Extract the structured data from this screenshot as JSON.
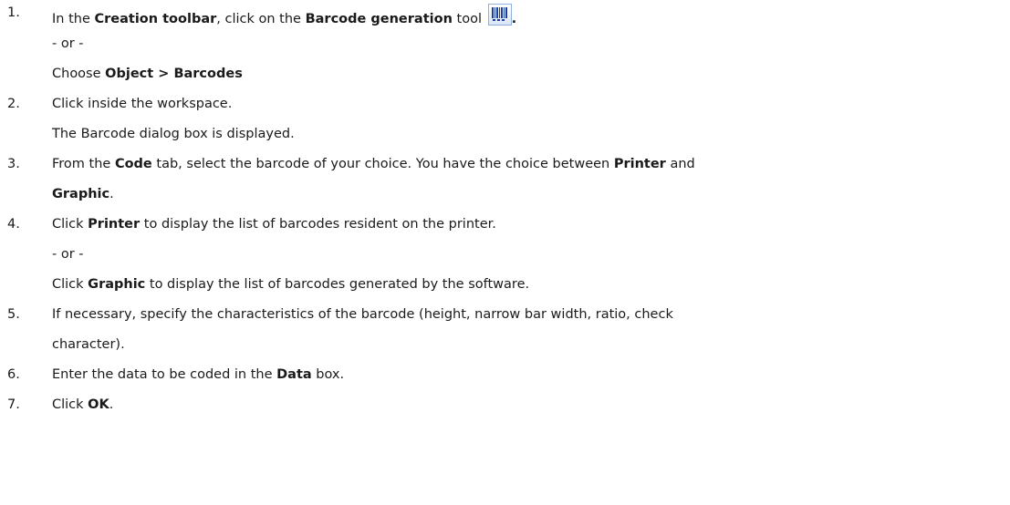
{
  "steps": [
    {
      "number": "1.",
      "line1": {
        "t1": "In the ",
        "b1": "Creation toolbar",
        "t2": ", click on the ",
        "b2": "Barcode generation",
        "t3": " tool ",
        "icon": "barcode-tool-icon",
        "b3": "."
      },
      "or": "- or -",
      "line3": {
        "t1": "Choose ",
        "b1": "Object > Barcodes"
      }
    },
    {
      "number": "2.",
      "line1": "Click inside the workspace.",
      "line2": "The Barcode dialog box is displayed."
    },
    {
      "number": "3.",
      "line1": {
        "t1": "From the ",
        "b1": "Code",
        "t2": " tab, select the barcode of your choice. You have the choice between ",
        "b2": "Printer",
        "t3": " and"
      },
      "line2": {
        "b1": "Graphic",
        "t1": "."
      }
    },
    {
      "number": "4.",
      "line1": {
        "t1": "Click ",
        "b1": "Printer",
        "t2": " to display the list of barcodes resident on the printer."
      },
      "or": "- or -",
      "line3": {
        "t1": "Click ",
        "b1": "Graphic",
        "t2": " to display the list of barcodes generated by the software."
      }
    },
    {
      "number": "5.",
      "line1": "If necessary, specify the characteristics of the barcode (height, narrow bar width, ratio, check",
      "line2": "character)."
    },
    {
      "number": "6.",
      "line1": {
        "t1": "Enter the data to be coded in the ",
        "b1": "Data",
        "t2": " box."
      }
    },
    {
      "number": "7.",
      "line1": {
        "t1": "Click ",
        "b1": "OK",
        "t2": "."
      }
    }
  ],
  "colors": {
    "text": "#1a1a1a",
    "icon_bars": "#1c3f9e",
    "icon_border": "#8fb0dc"
  }
}
